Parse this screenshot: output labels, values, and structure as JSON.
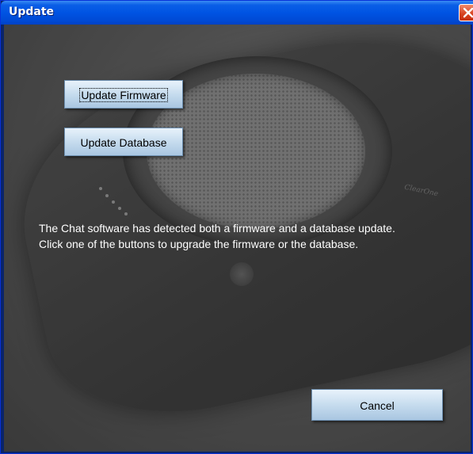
{
  "window": {
    "title": "Update",
    "close_icon": "close-icon"
  },
  "buttons": {
    "update_firmware": "Update Firmware",
    "update_database": "Update Database",
    "cancel": "Cancel"
  },
  "message": {
    "line1": "The Chat software has detected both a firmware and a database update.",
    "line2": "Click one of the buttons to upgrade the firmware or the database."
  },
  "colors": {
    "titlebar": "#0054e3",
    "close_button": "#d6401e",
    "button_face": "#c6dcee",
    "message_text": "#ffffff"
  }
}
